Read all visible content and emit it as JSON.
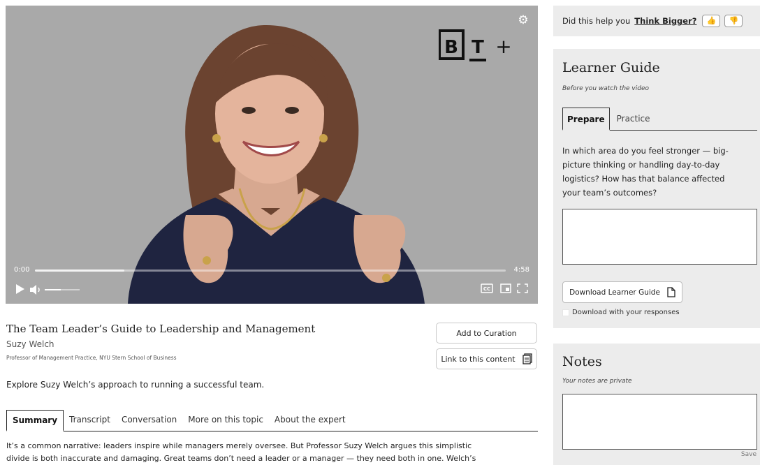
{
  "player": {
    "current_time": "0:00",
    "duration": "4:58",
    "progress_fraction": 0.0,
    "buffered_fraction": 0.19,
    "volume_fraction": 0.45,
    "logo_text": "BT+"
  },
  "video": {
    "title": "The Team Leader’s Guide to Leadership and Management",
    "author": "Suzy Welch",
    "role": "Professor of Management Practice, NYU Stern School of Business",
    "description": "Explore Suzy Welch’s approach to running a successful team."
  },
  "actions": {
    "add_curation": "Add to Curation",
    "link_content": "Link to this content"
  },
  "tabs": [
    "Summary",
    "Transcript",
    "Conversation",
    "More on this topic",
    "About the expert"
  ],
  "summary_text": "It’s a common narrative: leaders inspire while managers merely oversee. But Professor Suzy Welch argues this simplistic divide is both inaccurate and damaging. Great teams don’t need a leader or a manager — they need both in one. Welch’s concept of the",
  "feedback": {
    "prompt": "Did this help you",
    "link": "Think Bigger?"
  },
  "learner_guide": {
    "title": "Learner Guide",
    "subtitle": "Before you watch the video",
    "tabs": [
      "Prepare",
      "Practice"
    ],
    "question": "In which area do you feel stronger — big-picture thinking or handling day-to-day logistics? How has that balance affected your team’s outcomes?",
    "download_label": "Download Learner Guide",
    "download_with_responses": "Download with your responses"
  },
  "notes": {
    "title": "Notes",
    "subtitle": "Your notes are private",
    "save_label": "Save"
  },
  "colors": {
    "player_bg": "#a9a9a9",
    "panel_bg": "#ececec",
    "sweater": "#1f2440"
  }
}
